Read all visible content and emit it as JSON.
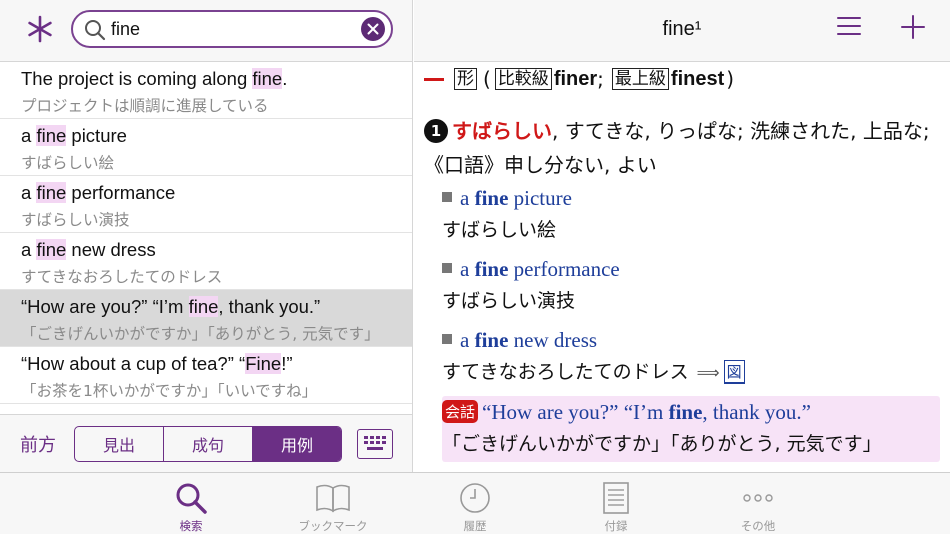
{
  "search": {
    "value": "fine",
    "placeholder": ""
  },
  "results": [
    {
      "pre": "The project is coming along ",
      "hl": "fine",
      "post": ".",
      "ja": "プロジェクトは順調に進展している",
      "selected": false
    },
    {
      "pre": "a ",
      "hl": "fine",
      "post": " picture",
      "ja": "すばらしい絵",
      "selected": false
    },
    {
      "pre": "a ",
      "hl": "fine",
      "post": " performance",
      "ja": "すばらしい演技",
      "selected": false
    },
    {
      "pre": "a ",
      "hl": "fine",
      "post": " new dress",
      "ja": "すてきなおろしたてのドレス",
      "selected": false
    },
    {
      "pre": "“How are you?” “I’m ",
      "hl": "fine",
      "post": ", thank you.”",
      "ja": "「ごきげんいかがですか」「ありがとう, 元気です」",
      "selected": true
    },
    {
      "pre": "“How about a cup of tea?” “",
      "hl": "Fine",
      "post": "!”",
      "ja": "「お茶を1杯いかがですか」「いいですね」",
      "selected": false
    }
  ],
  "segment": {
    "label": "前方",
    "options": [
      "見出",
      "成句",
      "用例"
    ],
    "active_index": 2
  },
  "entry": {
    "title": "fine¹",
    "pos": "形",
    "comparative_label": "比較級",
    "comparative": "finer",
    "superlative_label": "最上級",
    "superlative": "finest",
    "sense_number": "1",
    "sense_red": "すばらしい",
    "sense_rest": ", すてきな, りっぱな; 洗練された, 上品な; 《口語》申し分ない, よい",
    "examples": [
      {
        "pre": "a ",
        "bold": "fine",
        "post": " picture",
        "ja": "すばらしい絵"
      },
      {
        "pre": "a ",
        "bold": "fine",
        "post": " performance",
        "ja": "すばらしい演技"
      },
      {
        "pre": "a ",
        "bold": "fine",
        "post": " new dress",
        "ja": "すてきなおろしたてのドレス",
        "figure": "図"
      }
    ],
    "conversation": {
      "tag": "会話",
      "pre": "“How are you?” “I’m ",
      "bold": "fine",
      "post": ", thank you.”",
      "ja": "「ごきげんいかがですか」「ありがとう, 元気です」"
    }
  },
  "tabs": [
    {
      "label": "検索",
      "icon": "search-icon",
      "active": true
    },
    {
      "label": "ブックマーク",
      "icon": "book-icon",
      "active": false
    },
    {
      "label": "履歴",
      "icon": "clock-icon",
      "active": false
    },
    {
      "label": "付録",
      "icon": "document-icon",
      "active": false
    },
    {
      "label": "その他",
      "icon": "more-icon",
      "active": false
    }
  ],
  "colors": {
    "accent": "#6b2f85",
    "highlight": "#f3d6f3",
    "sense_red": "#d01818",
    "example_blue": "#1e3e9a",
    "conversation_bg": "#f7e3f7"
  }
}
